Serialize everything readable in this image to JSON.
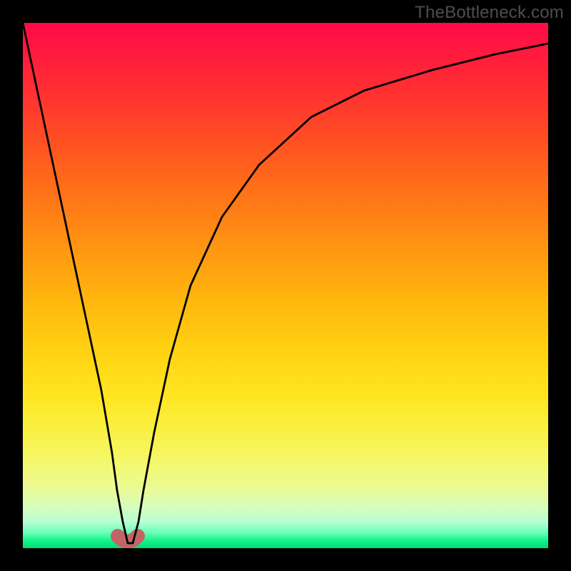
{
  "watermark": {
    "text": "TheBottleneck.com"
  },
  "chart_data": {
    "type": "line",
    "title": "",
    "xlabel": "",
    "ylabel": "",
    "xlim": [
      0,
      100
    ],
    "ylim": [
      0,
      100
    ],
    "grid": false,
    "series": [
      {
        "name": "bottleneck-curve",
        "color": "#000000",
        "x": [
          0,
          3,
          6,
          9,
          12,
          15,
          17,
          18,
          19,
          20,
          21,
          22,
          23,
          25,
          28,
          32,
          38,
          45,
          55,
          65,
          78,
          90,
          100
        ],
        "values": [
          100,
          86,
          72,
          58,
          44,
          30,
          18,
          11,
          5,
          1,
          1,
          5,
          11,
          22,
          36,
          50,
          63,
          73,
          82,
          87,
          91,
          94,
          96
        ]
      }
    ],
    "annotations": [
      {
        "name": "minimum-bump",
        "x": 20,
        "y": 1,
        "color": "#c06565"
      }
    ],
    "background_gradient": {
      "top": "#ff0b46",
      "bottom": "#02d973"
    }
  }
}
